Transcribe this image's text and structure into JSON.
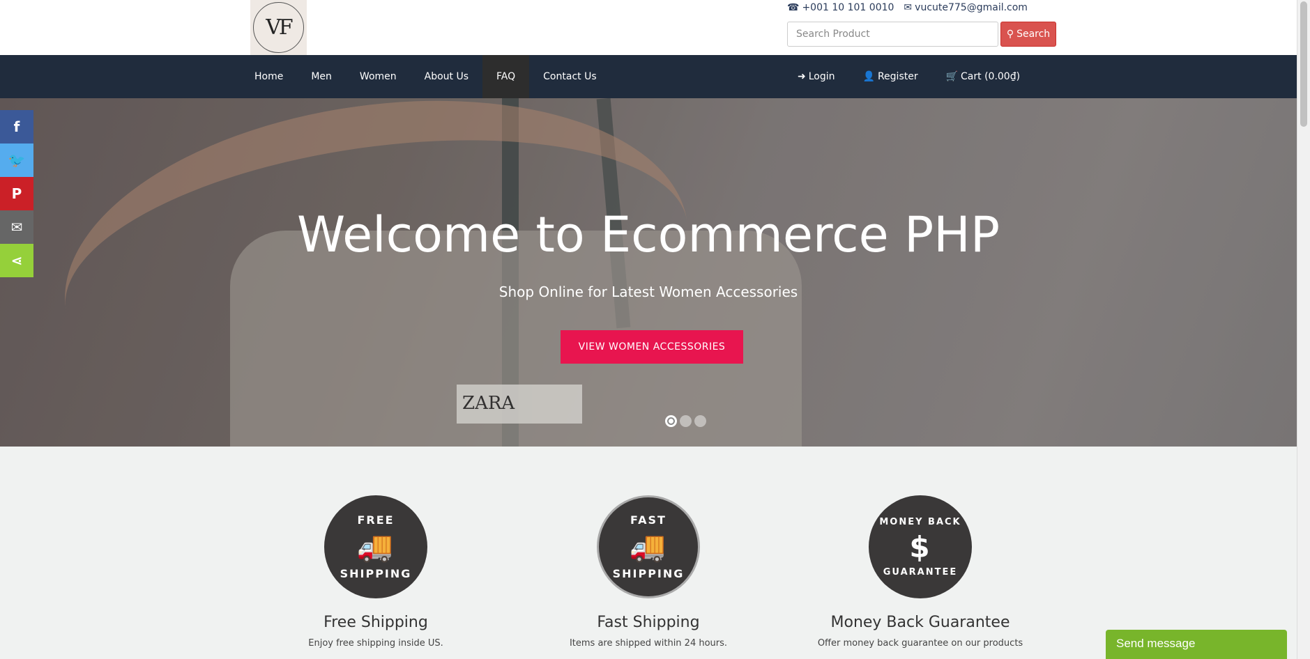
{
  "header": {
    "logo_text": "VF",
    "phone": "+001 10 101 0010",
    "email": "vucute775@gmail.com",
    "search_placeholder": "Search Product",
    "search_label": "Search"
  },
  "nav": {
    "items": [
      {
        "label": "Home"
      },
      {
        "label": "Men"
      },
      {
        "label": "Women"
      },
      {
        "label": "About Us"
      },
      {
        "label": "FAQ"
      },
      {
        "label": "Contact Us"
      }
    ],
    "login": "Login",
    "register": "Register",
    "cart": "Cart (0.00₫)"
  },
  "hero": {
    "title": "Welcome to Ecommerce PHP",
    "subtitle": "Shop Online for Latest Women Accessories",
    "button": "VIEW WOMEN ACCESSORIES",
    "tag_text": "ZARA",
    "slides": 3,
    "active_slide": 1
  },
  "social": [
    {
      "name": "facebook",
      "color": "#3b5998"
    },
    {
      "name": "twitter",
      "color": "#55acee"
    },
    {
      "name": "pinterest",
      "color": "#cb2027"
    },
    {
      "name": "email",
      "color": "#666666"
    },
    {
      "name": "share",
      "color": "#95d03a"
    }
  ],
  "features": [
    {
      "badge_top": "FREE",
      "badge_bottom": "SHIPPING",
      "title": "Free Shipping",
      "desc": "Enjoy free shipping inside US."
    },
    {
      "badge_top": "FAST",
      "badge_bottom": "SHIPPING",
      "title": "Fast Shipping",
      "desc": "Items are shipped within 24 hours."
    },
    {
      "badge_top": "MONEY BACK",
      "badge_bottom": "GUARANTEE",
      "title": "Money Back Guarantee",
      "desc": "Offer money back guarantee on our products"
    }
  ],
  "chat": {
    "label": "Send message"
  },
  "colors": {
    "navbar": "#202c3d",
    "accent": "#e8154f",
    "search_button": "#d9534f",
    "chat": "#78b52b"
  }
}
